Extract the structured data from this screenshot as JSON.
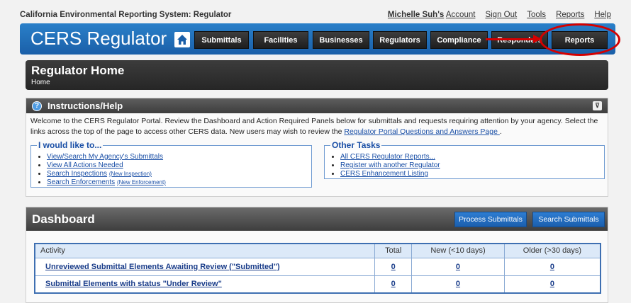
{
  "system_title": "California Environmental Reporting System: Regulator",
  "util": {
    "user_name": "Michelle Suh's",
    "account": "Account",
    "sign_out": "Sign Out",
    "tools": "Tools",
    "reports": "Reports",
    "help": "Help"
  },
  "brand": "CERS Regulator",
  "nav": [
    "Submittals",
    "Facilities",
    "Businesses",
    "Regulators",
    "Compliance",
    "Responders",
    "Reports"
  ],
  "page": {
    "title": "Regulator Home",
    "breadcrumb": "Home"
  },
  "instructions": {
    "title": "Instructions/Help",
    "text_before": "Welcome to the CERS Regulator Portal. Review the Dashboard and Action Required Panels below for submittals and requests requiring attention by your agency. Select the links across the top of the page to access other CERS data. New users may wish to review the ",
    "link": "Regulator Portal Questions and Answers Page ",
    "text_after": "."
  },
  "i_would_like": {
    "legend": "I would like to...",
    "items": [
      "View/Search My Agency's Submittals",
      "View All Actions Needed",
      "Search Inspections",
      "Search Enforcements"
    ],
    "sub": {
      "inspection": "(New Inspection)",
      "enforcement": "(New Enforcement)"
    }
  },
  "other_tasks": {
    "legend": "Other Tasks",
    "items": [
      "All CERS Regulator Reports...",
      "Register with another Regulator",
      "CERS Enhancement Listing"
    ]
  },
  "dashboard": {
    "title": "Dashboard",
    "process_btn": "Process Submittals",
    "search_btn": "Search Submittals",
    "columns": [
      "Activity",
      "Total",
      "New (<10 days)",
      "Older (>30 days)"
    ],
    "rows": [
      {
        "activity": "Unreviewed Submittal Elements Awaiting Review (\"Submitted\")",
        "total": "0",
        "new": "0",
        "older": "0"
      },
      {
        "activity": "Submittal Elements with status \"Under Review\"",
        "total": "0",
        "new": "0",
        "older": "0"
      }
    ]
  },
  "colors": {
    "header_blue": "#1a5fa8",
    "annotation_red": "#d40000"
  }
}
